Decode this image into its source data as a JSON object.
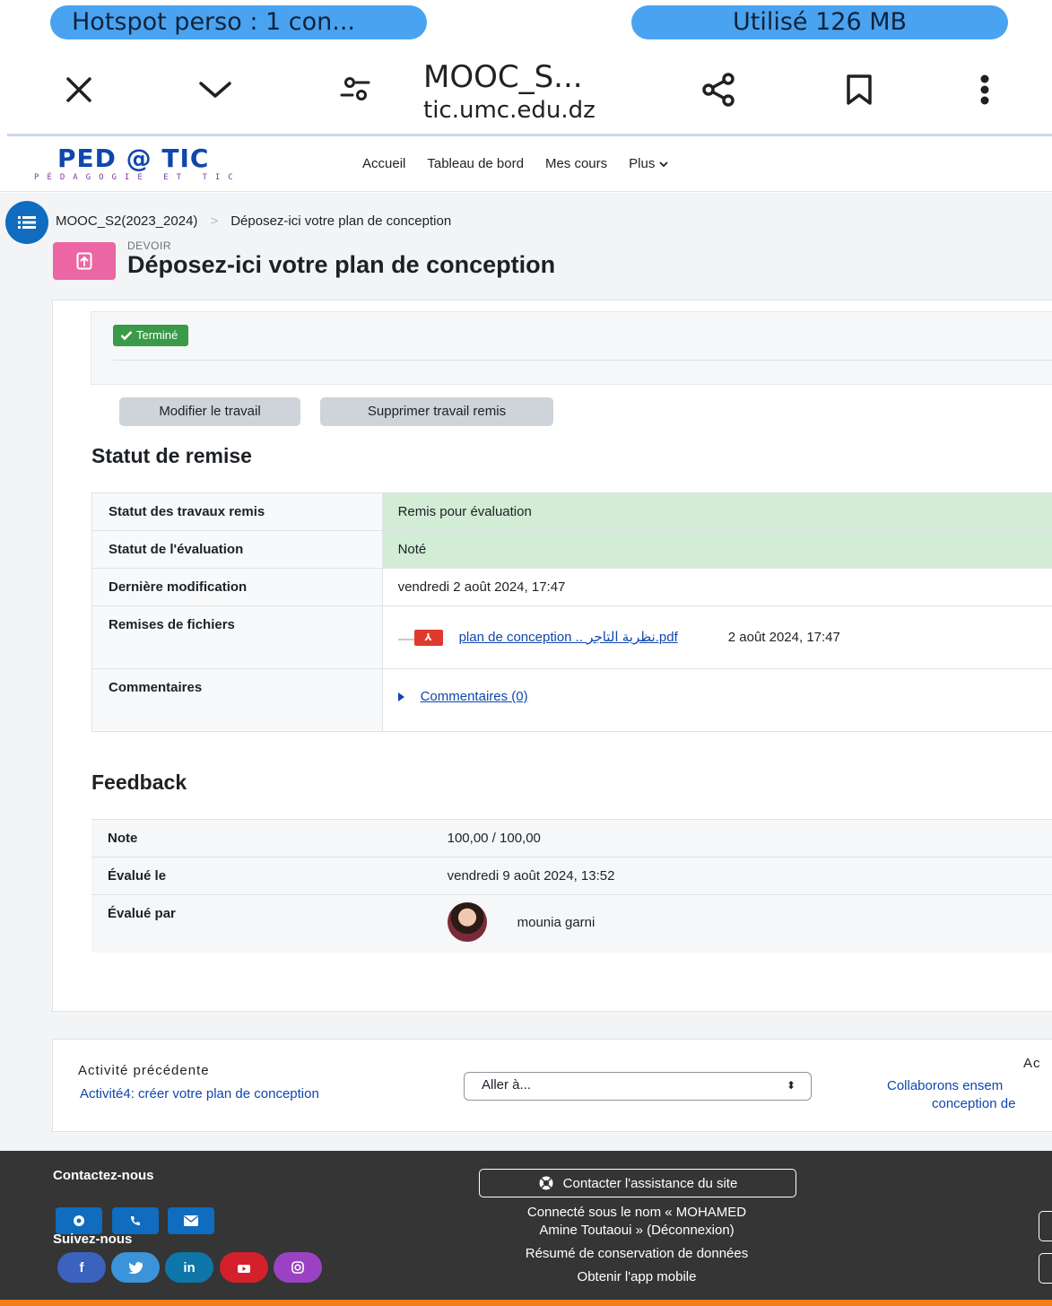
{
  "status_bar": {
    "hotspot": "Hotspot perso : 1 con...",
    "data_used": "Utilisé 126 MB"
  },
  "browser": {
    "title": "MOOC_S...",
    "domain": "tic.umc.edu.dz",
    "icons": [
      "close-icon",
      "chevron-down-icon",
      "site-settings-icon",
      "share-icon",
      "bookmark-icon",
      "more-vert-icon"
    ]
  },
  "site": {
    "logo_main": "PED @ TIC",
    "logo_sub": "PÉDAGOGIE ET TIC",
    "nav": [
      "Accueil",
      "Tableau de bord",
      "Mes cours"
    ],
    "nav_more": "Plus",
    "accent_color": "#0f6cbf"
  },
  "breadcrumb": {
    "course": "MOOC_S2(2023_2024)",
    "separator": ">",
    "current": "Déposez-ici votre plan de conception"
  },
  "header": {
    "activity_type": "DEVOIR",
    "title": "Déposez-ici votre plan de conception",
    "icon": "assign-upload-icon"
  },
  "completion": {
    "badge": "Terminé",
    "badge_color": "#3a9a4a"
  },
  "actions": {
    "edit": "Modifier le travail",
    "remove": "Supprimer travail remis"
  },
  "submission_status": {
    "heading": "Statut de remise",
    "rows": [
      {
        "label": "Statut des travaux remis",
        "value": "Remis pour évaluation"
      },
      {
        "label": "Statut de l'évaluation",
        "value": "Noté"
      },
      {
        "label": "Dernière modification",
        "value": "vendredi 2 août 2024, 17:47"
      },
      {
        "label": "Remises de fichiers"
      },
      {
        "label": "Commentaires"
      }
    ],
    "file": {
      "name": "plan de conception .. نظرية التاجر.pdf",
      "date": "2 août 2024, 17:47"
    },
    "comments_link": "Commentaires (0)"
  },
  "feedback": {
    "heading": "Feedback",
    "rows": [
      {
        "label": "Note",
        "value": "100,00 / 100,00"
      },
      {
        "label": "Évalué le",
        "value": "vendredi 9 août 2024, 13:52"
      },
      {
        "label": "Évalué par",
        "value": "mounia garni"
      }
    ]
  },
  "activity_nav": {
    "prev_label": "Activité précédente",
    "prev_link": "Activité4: créer votre plan de conception",
    "jump_placeholder": "Aller à...",
    "next_label": "Ac",
    "next_link_line1": "Collaborons ensem",
    "next_link_line2": "conception de"
  },
  "footer": {
    "contact_heading": "Contactez-nous",
    "follow_heading": "Suivez-nous",
    "support_button": "Contacter l'assistance du site",
    "logged_in_line1": "Connecté sous le nom « MOHAMED",
    "logged_in_line2": "Amine Toutaoui » (Déconnexion)",
    "data_retention": "Résumé de conservation de données",
    "mobile_app": "Obtenir l'app mobile",
    "social": [
      {
        "icon": "facebook-icon",
        "text": "f",
        "color": "#3b62bd"
      },
      {
        "icon": "twitter-icon",
        "text": "",
        "color": "#3b94d9"
      },
      {
        "icon": "linkedin-icon",
        "text": "in",
        "color": "#0e76a8"
      },
      {
        "icon": "youtube-icon",
        "text": "",
        "color": "#d3202a"
      },
      {
        "icon": "instagram-icon",
        "text": "",
        "color": "#9b42c4"
      }
    ],
    "bottom_strip_color": "#f07f1a"
  }
}
